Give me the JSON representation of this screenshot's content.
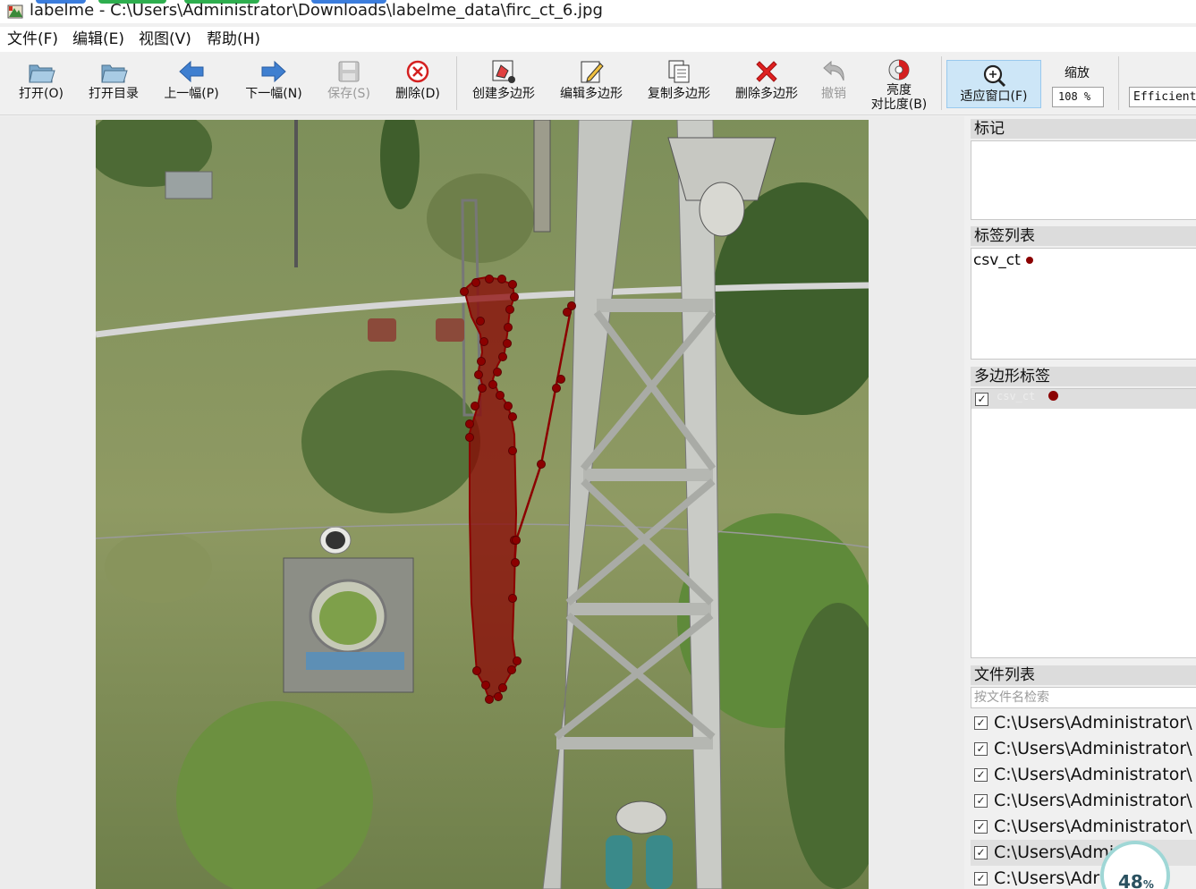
{
  "window": {
    "title": "labelme - C:\\Users\\Administrator\\Downloads\\labelme_data\\firc_ct_6.jpg"
  },
  "menu": [
    {
      "label": "文件(F)"
    },
    {
      "label": "编辑(E)"
    },
    {
      "label": "视图(V)"
    },
    {
      "label": "帮助(H)"
    }
  ],
  "toolbar": {
    "open": "打开(O)",
    "open_dir": "打开目录",
    "prev": "上一幅(P)",
    "next": "下一幅(N)",
    "save": "保存(S)",
    "delete_file": "删除(D)",
    "create_polygon": "创建多边形",
    "edit_polygon": "编辑多边形",
    "copy_polygon": "复制多边形",
    "delete_polygon": "删除多边形",
    "undo": "撤销",
    "brightness_line1": "亮度",
    "brightness_line2": "对比度(B)",
    "fit_window": "适应窗口(F)",
    "zoom_label": "缩放",
    "zoom_value": "108 %",
    "mode_value": "Efficient"
  },
  "colors": {
    "label_color": "#8b0000",
    "active_tool_bg": "#cde6f7"
  },
  "dock": {
    "flags_title": "标记",
    "label_list_title": "标签列表",
    "label_list_item": "csv_ct",
    "polygon_labels_title": "多边形标签",
    "polygon_item": "csv_ct",
    "file_list_title": "文件列表",
    "search_placeholder": "按文件名检索",
    "files": [
      "C:\\Users\\Administrator\\",
      "C:\\Users\\Administrator\\",
      "C:\\Users\\Administrator\\",
      "C:\\Users\\Administrator\\",
      "C:\\Users\\Administrator\\",
      "C:\\Users\\Admi",
      "C:\\Users\\Adr"
    ]
  },
  "overlay": {
    "progress_value": "48",
    "progress_unit": "%"
  }
}
